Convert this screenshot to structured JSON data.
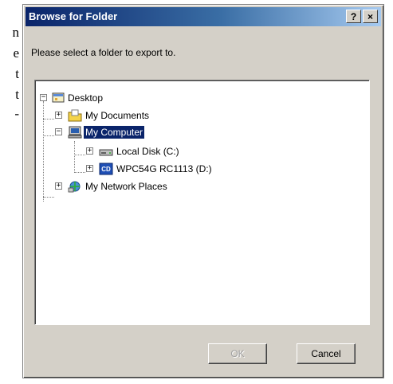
{
  "background_text": {
    "line1": "n",
    "line2": "e",
    "line3": "t",
    "line4": "t",
    "line5": "-"
  },
  "dialog": {
    "title": "Browse for Folder",
    "help_button": "?",
    "close_button": "×",
    "prompt": "Please select a folder to export to.",
    "tree": {
      "desktop": "Desktop",
      "my_documents": "My Documents",
      "my_computer": "My Computer",
      "local_disk": "Local Disk (C:)",
      "cd_drive": "WPC54G RC1113 (D:)",
      "network_places": "My Network Places",
      "selected": "My Computer"
    },
    "ok_button": "OK",
    "cancel_button": "Cancel"
  },
  "colors": {
    "title_gradient_start": "#0a246a",
    "title_gradient_end": "#a6caf0",
    "selection": "#0a246a",
    "face": "#d4d0c8"
  }
}
